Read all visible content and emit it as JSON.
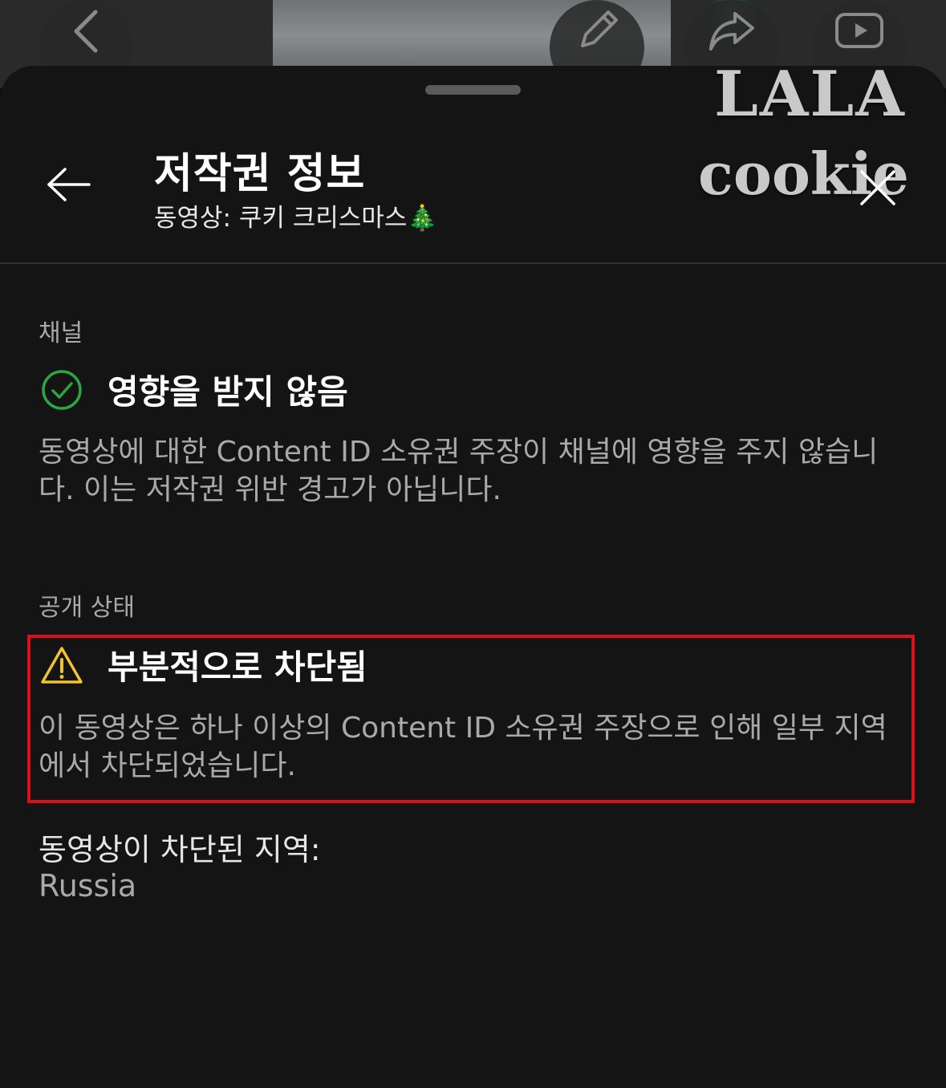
{
  "watermark": {
    "line1": "LALA",
    "line2": "cookie"
  },
  "header": {
    "title": "저작권 정보",
    "subtitle": "동영상: 쿠키 크리스마스🎄"
  },
  "channel": {
    "label": "채널",
    "status": "영향을 받지 않음",
    "description": "동영상에 대한 Content ID 소유권 주장이 채널에 영향을 주지 않습니다. 이는 저작권 위반 경고가 아닙니다."
  },
  "visibility": {
    "label": "공개 상태",
    "status": "부분적으로 차단됨",
    "description": "이 동영상은 하나 이상의 Content ID 소유권 주장으로 인해 일부 지역에서 차단되었습니다."
  },
  "blocked_regions": {
    "label": "동영상이 차단된 지역:",
    "value": "Russia"
  },
  "colors": {
    "check": "#2ba640",
    "warning": "#f2c230",
    "highlight": "#d8101a"
  },
  "icons": {
    "top_bar": [
      "chevron-left-icon",
      "pencil-icon",
      "share-icon",
      "youtube-icon"
    ],
    "header": [
      "arrow-left-icon",
      "close-icon"
    ],
    "status": [
      "check-circle-icon",
      "warning-icon"
    ]
  }
}
